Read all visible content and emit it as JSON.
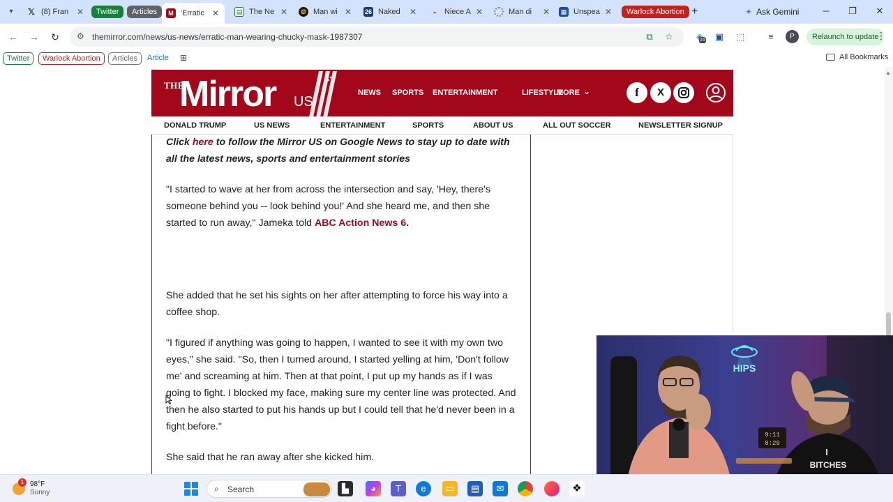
{
  "browser": {
    "tabs": [
      {
        "title": "(8) Fran",
        "icon": "x-logo-icon",
        "color": "#000000"
      },
      {
        "title": "Twitter",
        "is_group": true,
        "color": "#188038"
      },
      {
        "title": "Articles",
        "is_group": true,
        "color": "#5f6368"
      },
      {
        "title": "'Erratic",
        "icon": "mirror-favicon-icon",
        "color": "#a3081a",
        "active": true
      },
      {
        "title": "The Ne",
        "icon": "newsweek-favicon-icon",
        "color": "#188038"
      },
      {
        "title": "Man wi",
        "icon": "globe-favicon-icon",
        "color": "#1a1a1a"
      },
      {
        "title": "Naked",
        "icon": "news-favicon-icon",
        "color": "#1f3b73"
      },
      {
        "title": "Niece A",
        "icon": "red-dash-favicon-icon",
        "color": "#d93025"
      },
      {
        "title": "Man di",
        "icon": "loading-icon",
        "color": "#8a8a8a"
      },
      {
        "title": "Unspea",
        "icon": "site-favicon-icon",
        "color": "#1a4fa0"
      },
      {
        "title": "Warlock Abortion",
        "is_group": true,
        "color": "#c5221f"
      }
    ],
    "gemini_label": "Ask Gemini",
    "url": "themirror.com/news/us-news/erratic-man-wearing-chucky-mask-1987307",
    "extension_badge": "16",
    "profile_initial": "P",
    "relaunch_label": "Relaunch to update",
    "bookmarks": [
      {
        "label": "Twitter",
        "color": "#188038"
      },
      {
        "label": "Warlock Abortion",
        "color": "#c5221f"
      },
      {
        "label": "Articles",
        "color": "#5f6368"
      },
      {
        "label": "Article",
        "color": "#1a73e8"
      }
    ],
    "all_bookmarks_label": "All Bookmarks"
  },
  "site": {
    "logo_the": "THE",
    "logo_name": "Mirror",
    "logo_us": "US",
    "brand_color": "#a3081a",
    "main_nav": [
      "NEWS",
      "SPORTS",
      "ENTERTAINMENT",
      "LIFESTYLE",
      "MORE"
    ],
    "social": [
      "f",
      "X"
    ],
    "sub_nav": [
      "DONALD TRUMP",
      "US NEWS",
      "ENTERTAINMENT",
      "SPORTS",
      "ABOUT US",
      "ALL OUT SOCCER",
      "NEWSLETTER SIGNUP"
    ]
  },
  "article": {
    "promo_click": "Click ",
    "promo_link": "here",
    "promo_rest": " to follow the Mirror US on Google News to stay up to date with all the latest news, sports and entertainment stories",
    "para1": "\"I started to wave at her from across the intersection and say, 'Hey, there's someone behind you -- look behind you!' And she heard me, and then she started to run away,\" Jameka told ",
    "para1_link": "ABC Action News 6.",
    "para2": "She added that he set his sights on her after attempting to force his way into a coffee shop.",
    "para3": "\"I figured if anything was going to happen, I wanted to see it with my own two eyes,\" she said. \"So, then I turned around, I started yelling at him, 'Don't follow me' and screaming at him. Then at that point, I put up my hands as if I was going to fight. I blocked my face, making sure my center line was protected. And then he also started to put his hands up but I could tell that he'd never been in a fight before.\"",
    "para4": "She said that he ran away after she kicked him."
  },
  "webcam": {
    "neon_sign": "HIPS",
    "shirt_text_1": "I",
    "shirt_text_2": "BITCHES",
    "clock_1": "9:11",
    "clock_2": "8:29"
  },
  "taskbar": {
    "weather_badge": "1",
    "temperature": "98°F",
    "condition": "Sunny",
    "search_label": "Search"
  }
}
